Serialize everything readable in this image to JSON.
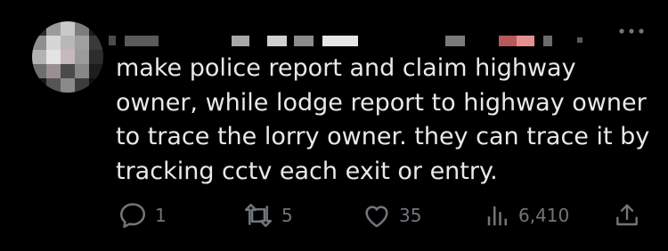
{
  "reply": {
    "text": "make police report and claim highway\nowner, while lodge report to highway owner\nto trace the lorry owner. they can trace it by\ntracking cctv each exit or entry."
  },
  "actions": {
    "reply_count": "1",
    "repost_count": "5",
    "like_count": "35",
    "views_count": "6,410"
  },
  "icons": {
    "reply": "reply-bubble-icon",
    "repost": "repost-icon",
    "like": "heart-icon",
    "views": "views-bar-chart-icon",
    "share": "share-upload-icon",
    "more": "more-dots-icon"
  },
  "colors": {
    "background": "#000000",
    "text": "#e7e9ea",
    "muted": "#71767b"
  }
}
